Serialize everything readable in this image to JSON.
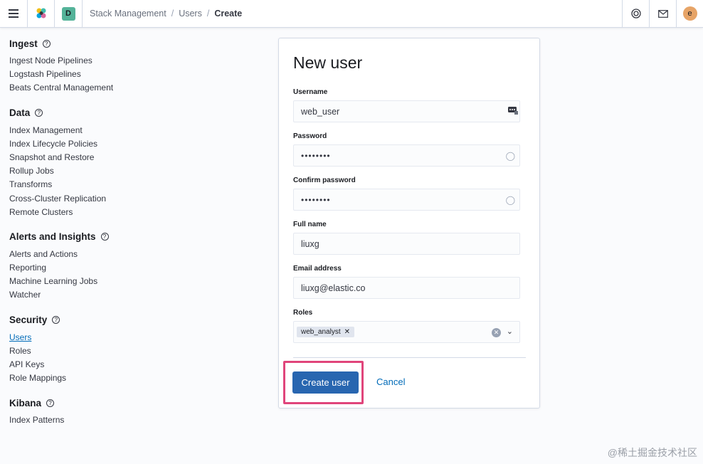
{
  "header": {
    "space_letter": "D",
    "breadcrumbs": [
      "Stack Management",
      "Users",
      "Create"
    ],
    "avatar_letter": "e",
    "icons": [
      "menu-icon",
      "elastic-logo-icon",
      "help-lifebuoy-icon",
      "mail-icon"
    ]
  },
  "sidebar": {
    "groups": [
      {
        "title": "Ingest",
        "items": [
          "Ingest Node Pipelines",
          "Logstash Pipelines",
          "Beats Central Management"
        ]
      },
      {
        "title": "Data",
        "items": [
          "Index Management",
          "Index Lifecycle Policies",
          "Snapshot and Restore",
          "Rollup Jobs",
          "Transforms",
          "Cross-Cluster Replication",
          "Remote Clusters"
        ]
      },
      {
        "title": "Alerts and Insights",
        "items": [
          "Alerts and Actions",
          "Reporting",
          "Machine Learning Jobs",
          "Watcher"
        ]
      },
      {
        "title": "Security",
        "items": [
          "Users",
          "Roles",
          "API Keys",
          "Role Mappings"
        ],
        "active": "Users"
      },
      {
        "title": "Kibana",
        "items": [
          "Index Patterns"
        ]
      }
    ]
  },
  "form": {
    "title": "New user",
    "username_label": "Username",
    "username_value": "web_user",
    "password_label": "Password",
    "password_value": "••••••••",
    "confirm_label": "Confirm password",
    "confirm_value": "••••••••",
    "fullname_label": "Full name",
    "fullname_value": "liuxg",
    "email_label": "Email address",
    "email_value": "liuxg@elastic.co",
    "roles_label": "Roles",
    "roles": [
      "web_analyst"
    ],
    "create_label": "Create user",
    "cancel_label": "Cancel"
  },
  "colors": {
    "primary": "#2866b0",
    "link": "#006bb8",
    "highlight": "#e0457b",
    "space_badge": "#54b399",
    "avatar": "#e7a467"
  },
  "watermark": "@稀土掘金技术社区"
}
